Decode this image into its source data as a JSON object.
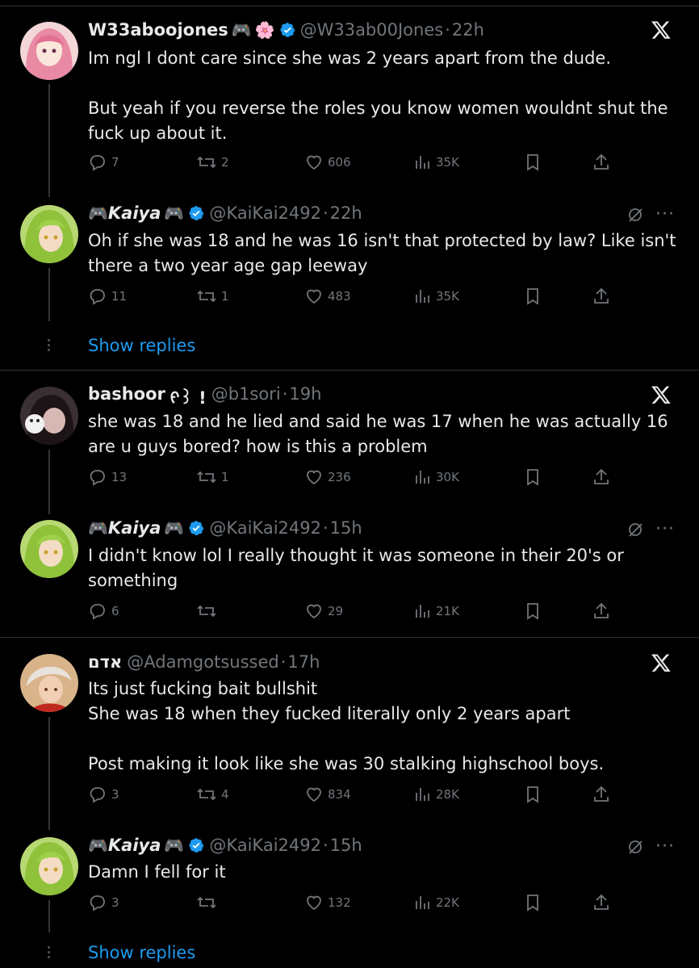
{
  "tweets": [
    {
      "name": "W33aboojones",
      "emoji": [
        "🎮",
        "🌸"
      ],
      "handle": "@W33ab00Jones",
      "time": "22h",
      "text": "Im ngl I dont care since she was 2 years apart from the dude.\n\nBut yeah if you reverse the roles you know women wouldnt shut the fuck up about it.",
      "replies": "7",
      "reposts": "2",
      "likes": "606",
      "views": "35K"
    },
    {
      "name": "Kaiya",
      "emoji_before": "🎮",
      "emoji": [
        "🎮"
      ],
      "handle": "@KaiKai2492",
      "time": "22h",
      "text": "Oh if she was 18 and he was 16 isn't that protected by law? Like isn't there a two year age gap leeway",
      "replies": "11",
      "reposts": "1",
      "likes": "483",
      "views": "35K"
    },
    {
      "name": "bashoor",
      "name_suffix": "ᠻ꒱ !",
      "handle": "@b1sori",
      "time": "19h",
      "text": "she was 18 and he lied and said he was 17 when he was actually 16 are u guys bored? how is this a problem",
      "replies": "13",
      "reposts": "1",
      "likes": "236",
      "views": "30K"
    },
    {
      "name": "Kaiya",
      "emoji_before": "🎮",
      "emoji": [
        "🎮"
      ],
      "handle": "@KaiKai2492",
      "time": "15h",
      "text": "I didn't know lol I really thought it was someone in their 20's or something",
      "replies": "6",
      "reposts": "",
      "likes": "29",
      "views": "21K"
    },
    {
      "name": "אדם",
      "handle": "@Adamgotsussed",
      "time": "17h",
      "text": "Its just fucking bait bullshit\nShe was 18 when they fucked literally only 2 years apart\n\nPost making it look like she was 30 stalking highschool boys.",
      "replies": "3",
      "reposts": "4",
      "likes": "834",
      "views": "28K"
    },
    {
      "name": "Kaiya",
      "emoji_before": "🎮",
      "emoji": [
        "🎮"
      ],
      "handle": "@KaiKai2492",
      "time": "15h",
      "text": "Damn I fell for it",
      "replies": "3",
      "reposts": "",
      "likes": "132",
      "views": "22K"
    }
  ],
  "show_replies_label": "Show replies",
  "separator": "·",
  "more_label": "···",
  "colors": {
    "background": "#000000",
    "text": "#e7e9ea",
    "muted": "#71767b",
    "link": "#1d9bf0",
    "verified": "#1d9bf0"
  }
}
